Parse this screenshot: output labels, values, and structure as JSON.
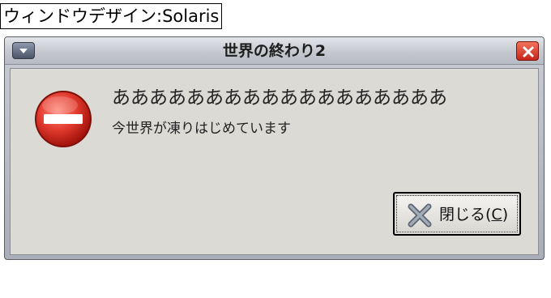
{
  "caption": "ウィンドウデザイン:Solaris",
  "window": {
    "title": "世界の終わり2"
  },
  "dialog": {
    "primary_text": "ああああああああああああああああああ",
    "secondary_text": "今世界が凍りはじめています",
    "icon": "stop-icon",
    "close_button": {
      "label_prefix": "閉じる(",
      "mnemonic": "C",
      "label_suffix": ")"
    }
  },
  "colors": {
    "stop_red": "#e23a2e",
    "client_bg": "#dcdad5",
    "close_red": "#d9352a"
  }
}
